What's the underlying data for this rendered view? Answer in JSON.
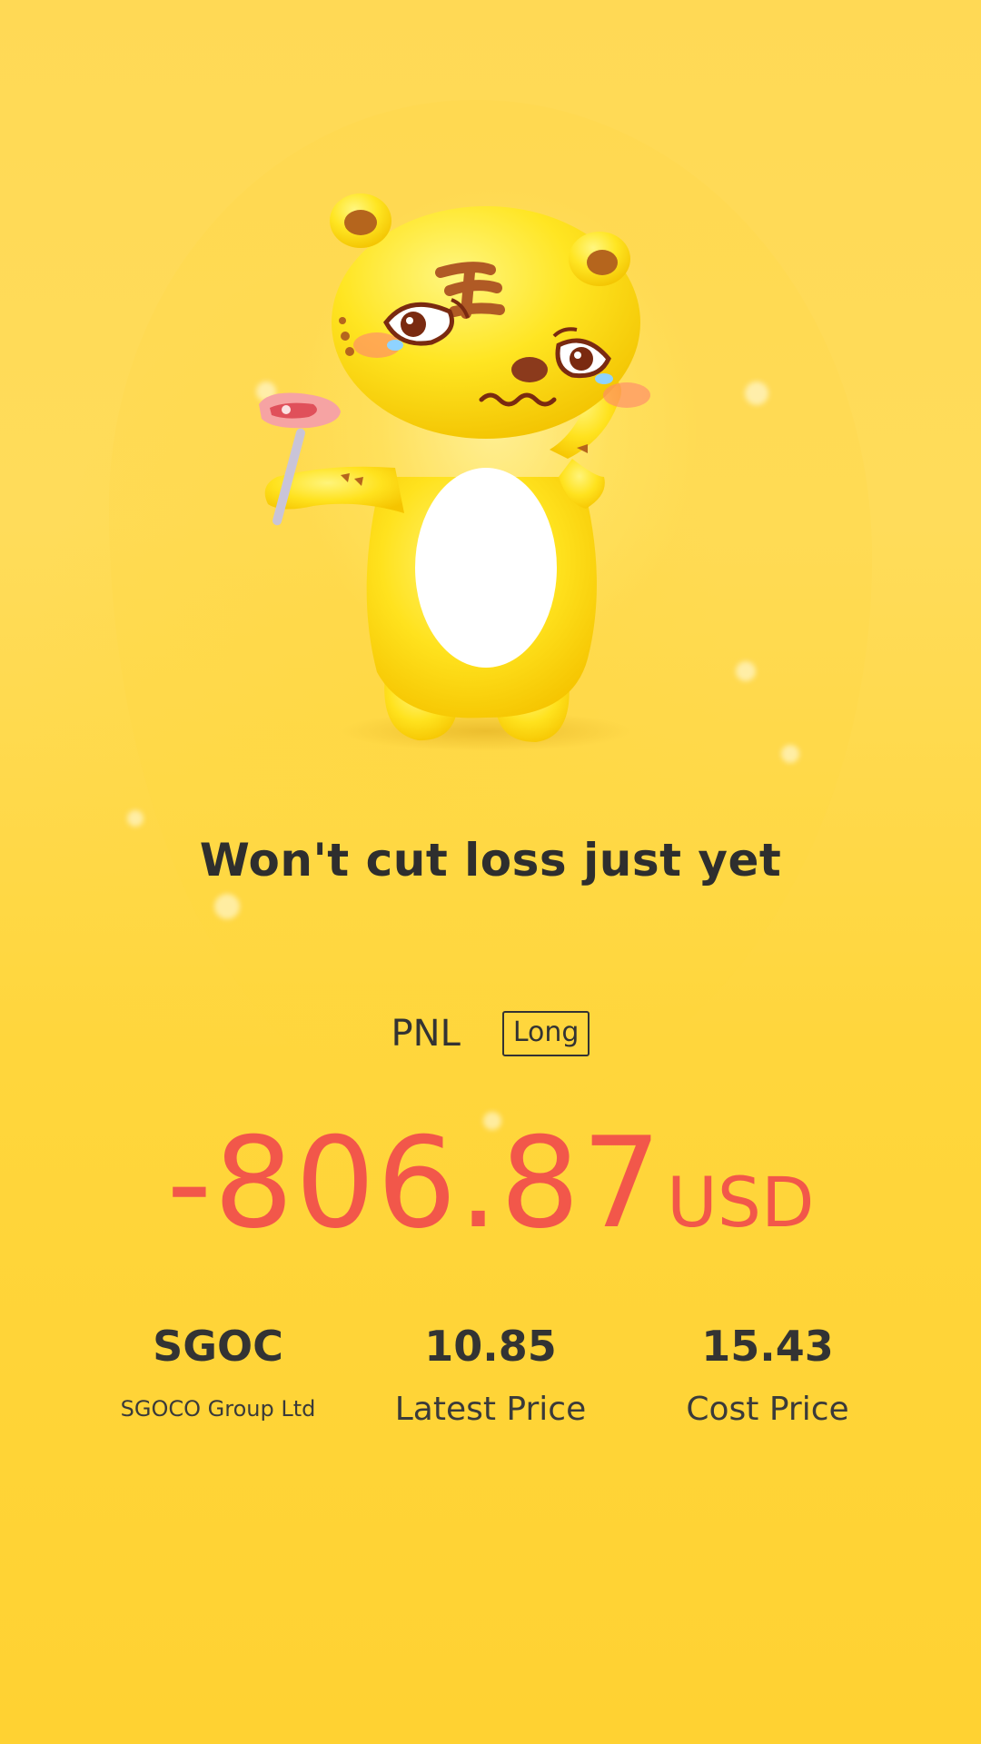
{
  "headline": "Won't cut loss just yet",
  "pnl": {
    "label": "PNL",
    "side": "Long",
    "value": "-806.87",
    "unit": "USD",
    "value_color": "#f2574a"
  },
  "stats": {
    "symbol": {
      "value": "SGOC",
      "label": "SGOCO Group Ltd"
    },
    "latest_price": {
      "value": "10.85",
      "label": "Latest Price"
    },
    "cost_price": {
      "value": "15.43",
      "label": "Cost Price"
    }
  },
  "illustration": {
    "icon": "crying-tiger-mascot-icon"
  },
  "colors": {
    "background": "#ffd84a",
    "accent_loss": "#f2574a",
    "text": "#2e2e2e"
  }
}
